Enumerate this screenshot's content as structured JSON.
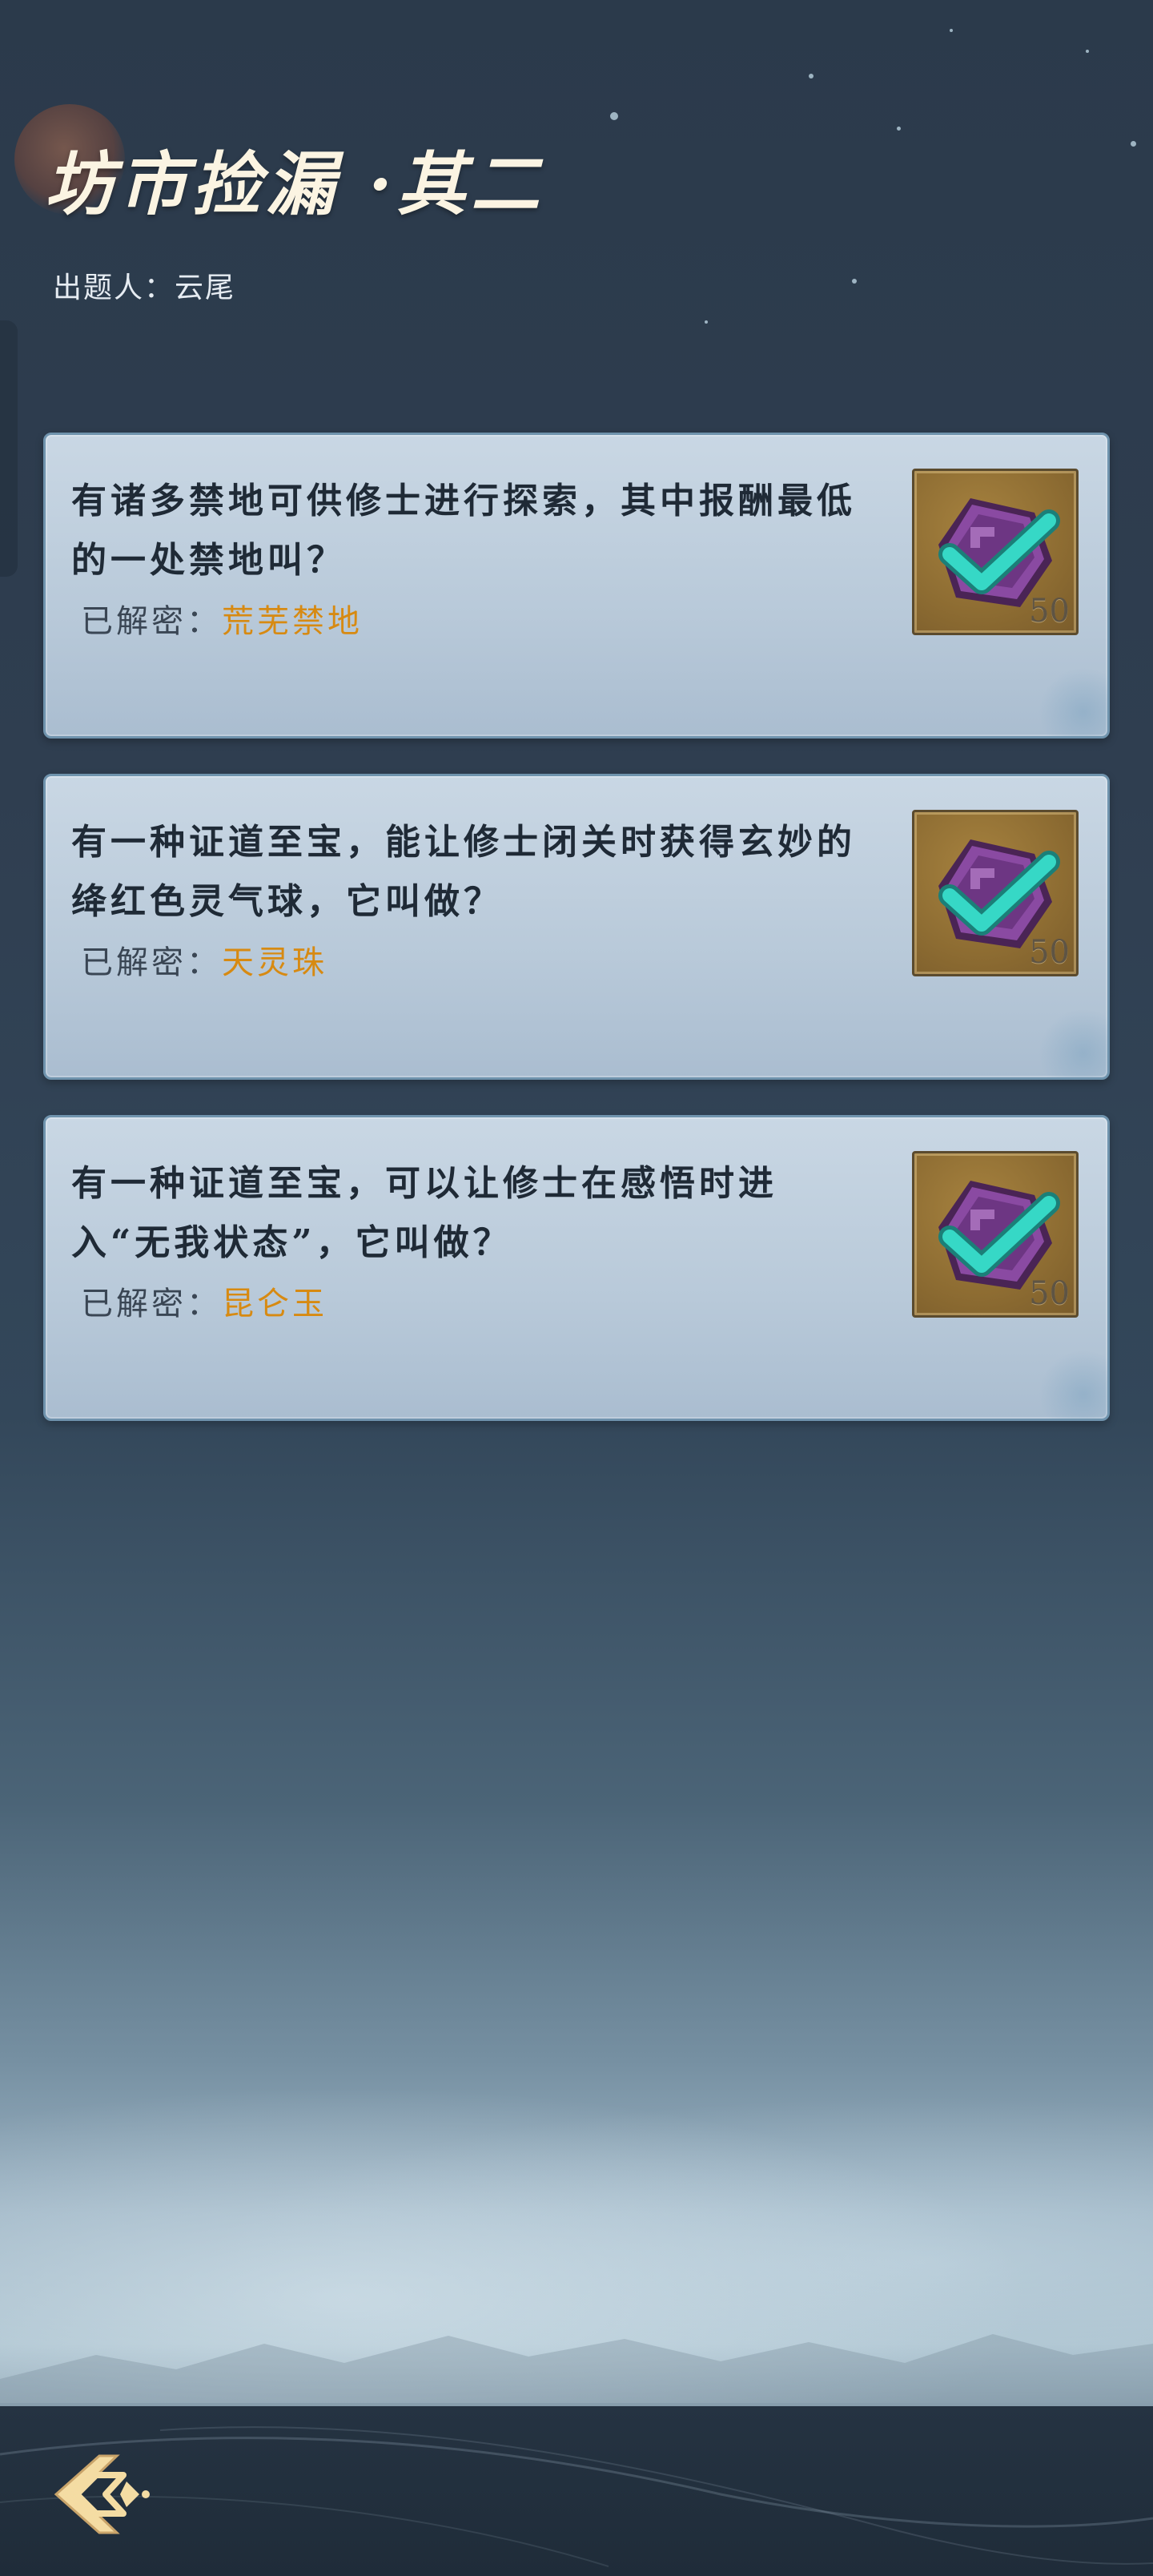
{
  "header": {
    "title": "坊市捡漏 ·其二",
    "author": "出题人：云尾"
  },
  "cards": [
    {
      "question": "有诸多禁地可供修士进行探索，其中报酬最低的一处禁地叫？",
      "answer_label": "已解密：",
      "answer_value": "荒芜禁地",
      "reward": "50",
      "reward_icon": "purple-token-check-icon"
    },
    {
      "question": "有一种证道至宝，能让修士闭关时获得玄妙的绛红色灵气球，它叫做？",
      "answer_label": "已解密：",
      "answer_value": "天灵珠",
      "reward": "50",
      "reward_icon": "purple-token-check-icon"
    },
    {
      "question": "有一种证道至宝，可以让修士在感悟时进入“无我状态”，它叫做？",
      "answer_label": "已解密：",
      "answer_value": "昆仑玉",
      "reward": "50",
      "reward_icon": "purple-token-check-icon"
    }
  ],
  "footer": {
    "back_icon": "back-arrow-icon"
  },
  "colors": {
    "answer": "#d78a12",
    "check": "#33d3c0",
    "token": "#7a3d8c"
  }
}
